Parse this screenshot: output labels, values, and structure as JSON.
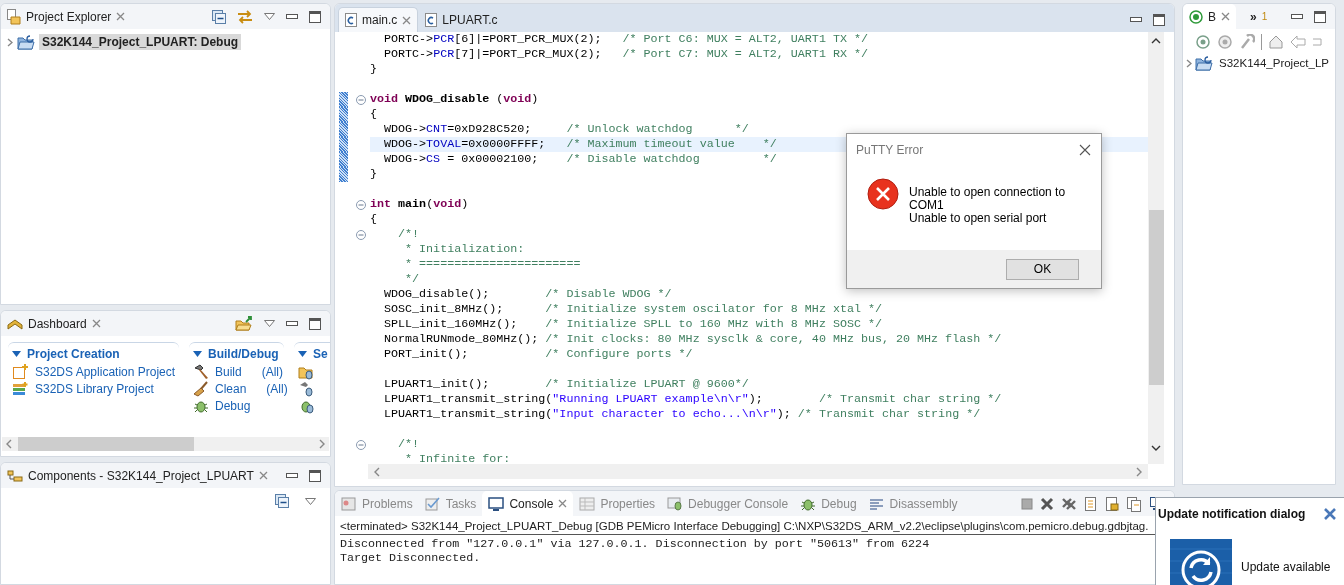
{
  "project_explorer": {
    "tab": {
      "label": "Project Explorer"
    },
    "tree": [
      {
        "label": "S32K144_Project_LPUART: Debug",
        "expanded": false,
        "selected": true
      }
    ]
  },
  "dashboard": {
    "tab": {
      "label": "Dashboard"
    },
    "sections": [
      {
        "title": "Project Creation",
        "expanded": true,
        "items": [
          {
            "kind": "app",
            "label": "S32DS Application Project"
          },
          {
            "kind": "library",
            "label": "S32DS Library Project"
          }
        ]
      },
      {
        "title": "Build/Debug",
        "expanded": true,
        "items": [
          {
            "kind": "build",
            "label": "Build",
            "scope": "(All)"
          },
          {
            "kind": "clean",
            "label": "Clean",
            "scope": "(All)"
          },
          {
            "kind": "debug",
            "label": "Debug"
          }
        ]
      },
      {
        "title": "Se",
        "expanded": true,
        "items": [
          {
            "kind": "import"
          },
          {
            "kind": "tool-launch"
          },
          {
            "kind": "bug-launch"
          }
        ]
      }
    ]
  },
  "components": {
    "tab": {
      "label": "Components - S32K144_Project_LPUART"
    }
  },
  "editor": {
    "tabs": [
      {
        "label": "main.c",
        "selected": true
      },
      {
        "label": "LPUART.c",
        "selected": false
      }
    ],
    "lines": [
      {
        "fold": false,
        "current": false,
        "marked": false,
        "segments": [
          {
            "kind": "plain",
            "text": "  PORTC->"
          },
          {
            "kind": "field",
            "text": "PCR"
          },
          {
            "kind": "plain",
            "text": "[6]|=PORT_PCR_MUX(2);   "
          },
          {
            "kind": "comment",
            "text": "/* Port C6: MUX = ALT2, UART1 TX */"
          }
        ]
      },
      {
        "fold": false,
        "current": false,
        "marked": false,
        "segments": [
          {
            "kind": "plain",
            "text": "  PORTC->"
          },
          {
            "kind": "field",
            "text": "PCR"
          },
          {
            "kind": "plain",
            "text": "[7]|=PORT_PCR_MUX(2);   "
          },
          {
            "kind": "comment",
            "text": "/* Port C7: MUX = ALT2, UART1 RX */"
          }
        ]
      },
      {
        "fold": false,
        "current": false,
        "marked": false,
        "segments": [
          {
            "kind": "plain",
            "text": "}"
          }
        ]
      },
      {
        "fold": false,
        "current": false,
        "marked": false
      },
      {
        "fold": true,
        "current": false,
        "marked": true,
        "segments": [
          {
            "kind": "keyword",
            "text": "void"
          },
          {
            "kind": "decl",
            "text": " WDOG_disable"
          },
          {
            "kind": "plain",
            "text": " ("
          },
          {
            "kind": "keyword",
            "text": "void"
          },
          {
            "kind": "plain",
            "text": ")"
          }
        ]
      },
      {
        "fold": false,
        "current": false,
        "marked": true,
        "segments": [
          {
            "kind": "plain",
            "text": "{"
          }
        ]
      },
      {
        "fold": false,
        "current": false,
        "marked": true,
        "segments": [
          {
            "kind": "plain",
            "text": "  WDOG->"
          },
          {
            "kind": "field",
            "text": "CNT"
          },
          {
            "kind": "plain",
            "text": "=0xD928C520;     "
          },
          {
            "kind": "comment",
            "text": "/* Unlock watchdog      */"
          }
        ]
      },
      {
        "fold": false,
        "current": true,
        "marked": true,
        "segments": [
          {
            "kind": "plain",
            "text": "  WDOG->"
          },
          {
            "kind": "field",
            "text": "TOVAL"
          },
          {
            "kind": "plain",
            "text": "=0x0000FFFF;   "
          },
          {
            "kind": "comment",
            "text": "/* Maximum timeout value    */"
          }
        ]
      },
      {
        "fold": false,
        "current": false,
        "marked": true,
        "segments": [
          {
            "kind": "plain",
            "text": "  WDOG->"
          },
          {
            "kind": "field",
            "text": "CS"
          },
          {
            "kind": "plain",
            "text": " = 0x00002100;    "
          },
          {
            "kind": "comment",
            "text": "/* Disable watchdog         */"
          }
        ]
      },
      {
        "fold": false,
        "current": false,
        "marked": true,
        "segments": [
          {
            "kind": "plain",
            "text": "}"
          }
        ]
      },
      {
        "fold": false,
        "current": false,
        "marked": false
      },
      {
        "fold": true,
        "current": false,
        "marked": false,
        "segments": [
          {
            "kind": "keyword",
            "text": "int"
          },
          {
            "kind": "decl",
            "text": " main"
          },
          {
            "kind": "plain",
            "text": "("
          },
          {
            "kind": "keyword",
            "text": "void"
          },
          {
            "kind": "plain",
            "text": ")"
          }
        ]
      },
      {
        "fold": false,
        "current": false,
        "marked": false,
        "segments": [
          {
            "kind": "plain",
            "text": "{"
          }
        ]
      },
      {
        "fold": true,
        "current": false,
        "marked": false,
        "segments": [
          {
            "kind": "comment",
            "text": "    /*!"
          }
        ]
      },
      {
        "fold": false,
        "current": false,
        "marked": false,
        "segments": [
          {
            "kind": "comment",
            "text": "     * Initialization:"
          }
        ]
      },
      {
        "fold": false,
        "current": false,
        "marked": false,
        "segments": [
          {
            "kind": "comment",
            "text": "     * ======================="
          }
        ]
      },
      {
        "fold": false,
        "current": false,
        "marked": false,
        "segments": [
          {
            "kind": "comment",
            "text": "     */"
          }
        ]
      },
      {
        "fold": false,
        "current": false,
        "marked": false,
        "segments": [
          {
            "kind": "plain",
            "text": "  WDOG_disable();        "
          },
          {
            "kind": "comment",
            "text": "/* Disable WDOG */"
          }
        ]
      },
      {
        "fold": false,
        "current": false,
        "marked": false,
        "segments": [
          {
            "kind": "plain",
            "text": "  SOSC_init_8MHz();      "
          },
          {
            "kind": "comment",
            "text": "/* Initialize system oscilator for 8 MHz xtal */"
          }
        ]
      },
      {
        "fold": false,
        "current": false,
        "marked": false,
        "segments": [
          {
            "kind": "plain",
            "text": "  SPLL_init_160MHz();    "
          },
          {
            "kind": "comment",
            "text": "/* Initialize SPLL to 160 MHz with 8 MHz SOSC */"
          }
        ]
      },
      {
        "fold": false,
        "current": false,
        "marked": false,
        "segments": [
          {
            "kind": "plain",
            "text": "  NormalRUNmode_80MHz(); "
          },
          {
            "kind": "comment",
            "text": "/* Init clocks: 80 MHz sysclk & core, 40 MHz bus, 20 MHz flash */"
          }
        ]
      },
      {
        "fold": false,
        "current": false,
        "marked": false,
        "segments": [
          {
            "kind": "plain",
            "text": "  PORT_init();           "
          },
          {
            "kind": "comment",
            "text": "/* Configure ports */"
          }
        ]
      },
      {
        "fold": false,
        "current": false,
        "marked": false
      },
      {
        "fold": false,
        "current": false,
        "marked": false,
        "segments": [
          {
            "kind": "plain",
            "text": "  LPUART1_init();        "
          },
          {
            "kind": "comment",
            "text": "/* Initialize LPUART @ 9600*/"
          }
        ]
      },
      {
        "fold": false,
        "current": false,
        "marked": false,
        "segments": [
          {
            "kind": "plain",
            "text": "  LPUART1_transmit_string("
          },
          {
            "kind": "string",
            "text": "\"Running LPUART example\\n\\r\""
          },
          {
            "kind": "plain",
            "text": ");        "
          },
          {
            "kind": "comment",
            "text": "/* Transmit char string */"
          }
        ]
      },
      {
        "fold": false,
        "current": false,
        "marked": false,
        "segments": [
          {
            "kind": "plain",
            "text": "  LPUART1_transmit_string("
          },
          {
            "kind": "string",
            "text": "\"Input character to echo...\\n\\r\""
          },
          {
            "kind": "plain",
            "text": "); "
          },
          {
            "kind": "comment",
            "text": "/* Transmit char string */"
          }
        ]
      },
      {
        "fold": false,
        "current": false,
        "marked": false
      },
      {
        "fold": true,
        "current": false,
        "marked": false,
        "segments": [
          {
            "kind": "comment",
            "text": "    /*!"
          }
        ]
      },
      {
        "fold": false,
        "current": false,
        "marked": false,
        "segments": [
          {
            "kind": "comment",
            "text": "     * Infinite for:"
          }
        ]
      }
    ]
  },
  "outline": {
    "tabs": [
      {
        "label": "B",
        "selected": true
      }
    ],
    "overflow": {
      "glyph": "»",
      "count": "1"
    },
    "tree": [
      {
        "label": "S32K144_Project_LP",
        "expanded": false,
        "selected": false
      }
    ]
  },
  "console": {
    "tabs": [
      {
        "kind": "problems",
        "label": "Problems",
        "selected": false
      },
      {
        "kind": "tasks",
        "label": "Tasks",
        "selected": false
      },
      {
        "kind": "console",
        "label": "Console",
        "selected": true
      },
      {
        "kind": "properties",
        "label": "Properties",
        "selected": false
      },
      {
        "kind": "debugger-console",
        "label": "Debugger Console",
        "selected": false
      },
      {
        "kind": "debug",
        "label": "Debug",
        "selected": false
      },
      {
        "kind": "disassembly",
        "label": "Disassembly",
        "selected": false
      }
    ],
    "lines": [
      {
        "kind": "header",
        "text": "<terminated> S32K144_Project_LPUART_Debug [GDB PEMicro Interface Debugging] C:\\NXP\\S32DS_ARM_v2.2\\eclipse\\plugins\\com.pemicro.debug.gdbjtag."
      },
      {
        "kind": "output",
        "text": "Disconnected from \"127.0.0.1\" via 127.0.0.1. Disconnection by port \"50613\" from 6224"
      },
      {
        "kind": "output",
        "text": "Target Disconnected."
      }
    ]
  },
  "dialog": {
    "title": "PuTTY Error",
    "kind": "error",
    "message": [
      "Unable to open connection to",
      "COM1",
      "Unable to open serial port"
    ],
    "buttons": [
      "OK"
    ]
  },
  "notification": {
    "title": "Update notification dialog",
    "message": "Update available"
  }
}
